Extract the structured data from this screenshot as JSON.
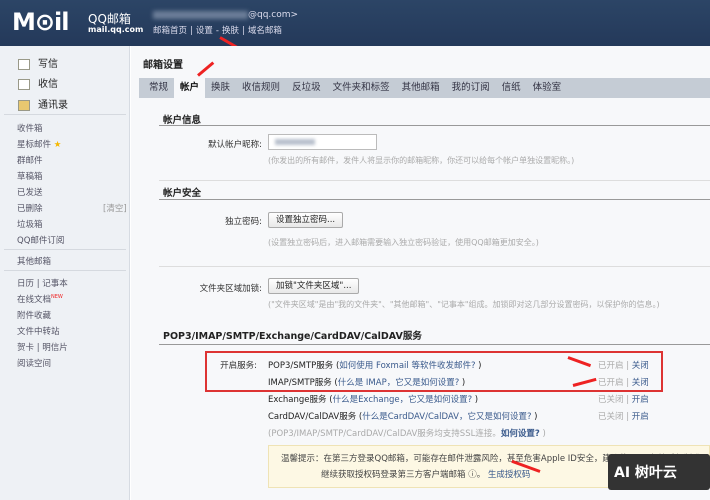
{
  "header": {
    "logo": "M⊙il",
    "brand": "QQ邮箱",
    "domain": "mail.qq.com",
    "email_suffix": "@qq.com>",
    "nav": [
      "邮箱首页",
      "|",
      "设置",
      "-",
      "换肤",
      "|",
      "域名邮箱"
    ]
  },
  "sidebar": {
    "compose": "写信",
    "inbox_action": "收信",
    "contacts": "通讯录",
    "folders": [
      "收件箱",
      "星标邮件",
      "群邮件",
      "草稿箱",
      "已发送",
      "已删除",
      "垃圾箱",
      "QQ邮件订阅"
    ],
    "clear": "[清空]",
    "star": "★",
    "other": "其他邮箱",
    "tools": [
      "日历 | 记事本",
      "在线文档",
      "附件收藏",
      "文件中转站",
      "贺卡 | 明信片",
      "阅读空间"
    ],
    "new_badge": "NEW"
  },
  "main": {
    "title": "邮箱设置",
    "tabs": [
      "常规",
      "帐户",
      "换肤",
      "收信规则",
      "反垃圾",
      "文件夹和标签",
      "其他邮箱",
      "我的订阅",
      "信纸",
      "体验室"
    ],
    "account_info": {
      "heading": "帐户信息",
      "nickname_label": "默认帐户昵称:",
      "nickname_hint": "(你发出的所有邮件，发件人将显示你的邮箱昵称，你还可以给每个帐户单独设置昵称。)"
    },
    "security": {
      "heading": "帐户安全",
      "pwd_label": "独立密码:",
      "pwd_button": "设置独立密码...",
      "pwd_hint": "(设置独立密码后，进入邮箱需要输入独立密码验证，使用QQ邮箱更加安全。)",
      "lock_label": "文件夹区域加锁:",
      "lock_button": "加锁\"文件夹区域\"...",
      "lock_hint": "(\"文件夹区域\"是由\"我的文件夹\"、\"其他邮箱\"、\"记事本\"组成。加锁即对这几部分设置密码，以保护你的信息。)"
    },
    "services": {
      "heading": "POP3/IMAP/SMTP/Exchange/CardDAV/CalDAV服务",
      "label": "开启服务:",
      "rows": [
        {
          "name": "POP3/SMTP服务 (",
          "link": "如何使用 Foxmail 等软件收发邮件?",
          "end": " )",
          "status": "已开启 |",
          "action": "关闭"
        },
        {
          "name": "IMAP/SMTP服务 (",
          "link": "什么是 IMAP，它又是如何设置?",
          "end": " )",
          "status": "已开启 |",
          "action": "关闭"
        },
        {
          "name": "Exchange服务 (",
          "link": "什么是Exchange，它又是如何设置?",
          "end": " )",
          "status": "已关闭 |",
          "action": "开启"
        },
        {
          "name": "CardDAV/CalDAV服务 (",
          "link": "什么是CardDAV/CalDAV，它又是如何设置?",
          "end": " )",
          "status": "已关闭 |",
          "action": "开启"
        }
      ],
      "ssl_note": "(POP3/IMAP/SMTP/CardDAV/CalDAV服务均支持SSL连接。",
      "ssl_link": "如何设置?",
      "ssl_end": " )"
    },
    "tip": {
      "line1": "温馨提示：在第三方登录QQ邮箱，可能存在邮件泄露风险，甚至危害Apple ID安全，建议使用QQ邮箱手机版登录。",
      "line2": "继续获取授权码登录第三方客户端邮箱 ⓘ。",
      "link": "生成授权码"
    }
  },
  "watermark": "AI 树叶云"
}
